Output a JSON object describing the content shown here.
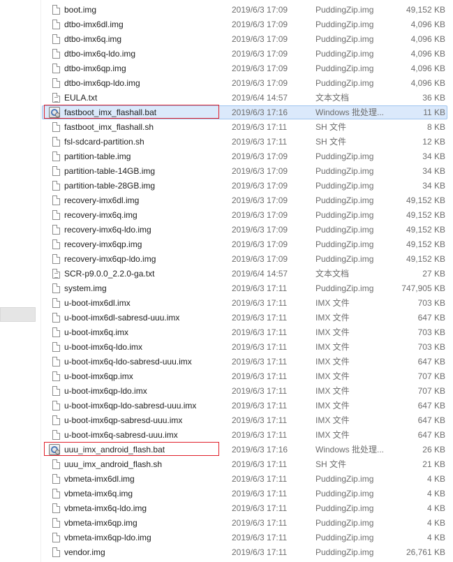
{
  "files": [
    {
      "name": "boot.img",
      "date": "2019/6/3 17:09",
      "type": "PuddingZip.img",
      "size": "49,152 KB",
      "icon": "file-icon"
    },
    {
      "name": "dtbo-imx6dl.img",
      "date": "2019/6/3 17:09",
      "type": "PuddingZip.img",
      "size": "4,096 KB",
      "icon": "file-icon"
    },
    {
      "name": "dtbo-imx6q.img",
      "date": "2019/6/3 17:09",
      "type": "PuddingZip.img",
      "size": "4,096 KB",
      "icon": "file-icon"
    },
    {
      "name": "dtbo-imx6q-ldo.img",
      "date": "2019/6/3 17:09",
      "type": "PuddingZip.img",
      "size": "4,096 KB",
      "icon": "file-icon"
    },
    {
      "name": "dtbo-imx6qp.img",
      "date": "2019/6/3 17:09",
      "type": "PuddingZip.img",
      "size": "4,096 KB",
      "icon": "file-icon"
    },
    {
      "name": "dtbo-imx6qp-ldo.img",
      "date": "2019/6/3 17:09",
      "type": "PuddingZip.img",
      "size": "4,096 KB",
      "icon": "file-icon"
    },
    {
      "name": "EULA.txt",
      "date": "2019/6/4 14:57",
      "type": "文本文档",
      "size": "36 KB",
      "icon": "text-file-icon"
    },
    {
      "name": "fastboot_imx_flashall.bat",
      "date": "2019/6/3 17:16",
      "type": "Windows 批处理...",
      "size": "11 KB",
      "icon": "batch-file-icon",
      "selected": true,
      "highlighted": true
    },
    {
      "name": "fastboot_imx_flashall.sh",
      "date": "2019/6/3 17:11",
      "type": "SH 文件",
      "size": "8 KB",
      "icon": "file-icon"
    },
    {
      "name": "fsl-sdcard-partition.sh",
      "date": "2019/6/3 17:11",
      "type": "SH 文件",
      "size": "12 KB",
      "icon": "file-icon"
    },
    {
      "name": "partition-table.img",
      "date": "2019/6/3 17:09",
      "type": "PuddingZip.img",
      "size": "34 KB",
      "icon": "file-icon"
    },
    {
      "name": "partition-table-14GB.img",
      "date": "2019/6/3 17:09",
      "type": "PuddingZip.img",
      "size": "34 KB",
      "icon": "file-icon"
    },
    {
      "name": "partition-table-28GB.img",
      "date": "2019/6/3 17:09",
      "type": "PuddingZip.img",
      "size": "34 KB",
      "icon": "file-icon"
    },
    {
      "name": "recovery-imx6dl.img",
      "date": "2019/6/3 17:09",
      "type": "PuddingZip.img",
      "size": "49,152 KB",
      "icon": "file-icon"
    },
    {
      "name": "recovery-imx6q.img",
      "date": "2019/6/3 17:09",
      "type": "PuddingZip.img",
      "size": "49,152 KB",
      "icon": "file-icon"
    },
    {
      "name": "recovery-imx6q-ldo.img",
      "date": "2019/6/3 17:09",
      "type": "PuddingZip.img",
      "size": "49,152 KB",
      "icon": "file-icon"
    },
    {
      "name": "recovery-imx6qp.img",
      "date": "2019/6/3 17:09",
      "type": "PuddingZip.img",
      "size": "49,152 KB",
      "icon": "file-icon"
    },
    {
      "name": "recovery-imx6qp-ldo.img",
      "date": "2019/6/3 17:09",
      "type": "PuddingZip.img",
      "size": "49,152 KB",
      "icon": "file-icon"
    },
    {
      "name": "SCR-p9.0.0_2.2.0-ga.txt",
      "date": "2019/6/4 14:57",
      "type": "文本文档",
      "size": "27 KB",
      "icon": "text-file-icon"
    },
    {
      "name": "system.img",
      "date": "2019/6/3 17:11",
      "type": "PuddingZip.img",
      "size": "747,905 KB",
      "icon": "file-icon"
    },
    {
      "name": "u-boot-imx6dl.imx",
      "date": "2019/6/3 17:11",
      "type": "IMX 文件",
      "size": "703 KB",
      "icon": "file-icon"
    },
    {
      "name": "u-boot-imx6dl-sabresd-uuu.imx",
      "date": "2019/6/3 17:11",
      "type": "IMX 文件",
      "size": "647 KB",
      "icon": "file-icon"
    },
    {
      "name": "u-boot-imx6q.imx",
      "date": "2019/6/3 17:11",
      "type": "IMX 文件",
      "size": "703 KB",
      "icon": "file-icon"
    },
    {
      "name": "u-boot-imx6q-ldo.imx",
      "date": "2019/6/3 17:11",
      "type": "IMX 文件",
      "size": "703 KB",
      "icon": "file-icon"
    },
    {
      "name": "u-boot-imx6q-ldo-sabresd-uuu.imx",
      "date": "2019/6/3 17:11",
      "type": "IMX 文件",
      "size": "647 KB",
      "icon": "file-icon"
    },
    {
      "name": "u-boot-imx6qp.imx",
      "date": "2019/6/3 17:11",
      "type": "IMX 文件",
      "size": "707 KB",
      "icon": "file-icon"
    },
    {
      "name": "u-boot-imx6qp-ldo.imx",
      "date": "2019/6/3 17:11",
      "type": "IMX 文件",
      "size": "707 KB",
      "icon": "file-icon"
    },
    {
      "name": "u-boot-imx6qp-ldo-sabresd-uuu.imx",
      "date": "2019/6/3 17:11",
      "type": "IMX 文件",
      "size": "647 KB",
      "icon": "file-icon"
    },
    {
      "name": "u-boot-imx6qp-sabresd-uuu.imx",
      "date": "2019/6/3 17:11",
      "type": "IMX 文件",
      "size": "647 KB",
      "icon": "file-icon"
    },
    {
      "name": "u-boot-imx6q-sabresd-uuu.imx",
      "date": "2019/6/3 17:11",
      "type": "IMX 文件",
      "size": "647 KB",
      "icon": "file-icon"
    },
    {
      "name": "uuu_imx_android_flash.bat",
      "date": "2019/6/3 17:16",
      "type": "Windows 批处理...",
      "size": "26 KB",
      "icon": "batch-file-icon",
      "highlighted": true
    },
    {
      "name": "uuu_imx_android_flash.sh",
      "date": "2019/6/3 17:11",
      "type": "SH 文件",
      "size": "21 KB",
      "icon": "file-icon"
    },
    {
      "name": "vbmeta-imx6dl.img",
      "date": "2019/6/3 17:11",
      "type": "PuddingZip.img",
      "size": "4 KB",
      "icon": "file-icon"
    },
    {
      "name": "vbmeta-imx6q.img",
      "date": "2019/6/3 17:11",
      "type": "PuddingZip.img",
      "size": "4 KB",
      "icon": "file-icon"
    },
    {
      "name": "vbmeta-imx6q-ldo.img",
      "date": "2019/6/3 17:11",
      "type": "PuddingZip.img",
      "size": "4 KB",
      "icon": "file-icon"
    },
    {
      "name": "vbmeta-imx6qp.img",
      "date": "2019/6/3 17:11",
      "type": "PuddingZip.img",
      "size": "4 KB",
      "icon": "file-icon"
    },
    {
      "name": "vbmeta-imx6qp-ldo.img",
      "date": "2019/6/3 17:11",
      "type": "PuddingZip.img",
      "size": "4 KB",
      "icon": "file-icon"
    },
    {
      "name": "vendor.img",
      "date": "2019/6/3 17:11",
      "type": "PuddingZip.img",
      "size": "26,761 KB",
      "icon": "file-icon"
    }
  ],
  "colors": {
    "selection_fill": "#dbe9fb",
    "selection_border": "#9fc4ee",
    "annotation_red": "#e0202a",
    "secondary_text": "#6d6d6d"
  }
}
